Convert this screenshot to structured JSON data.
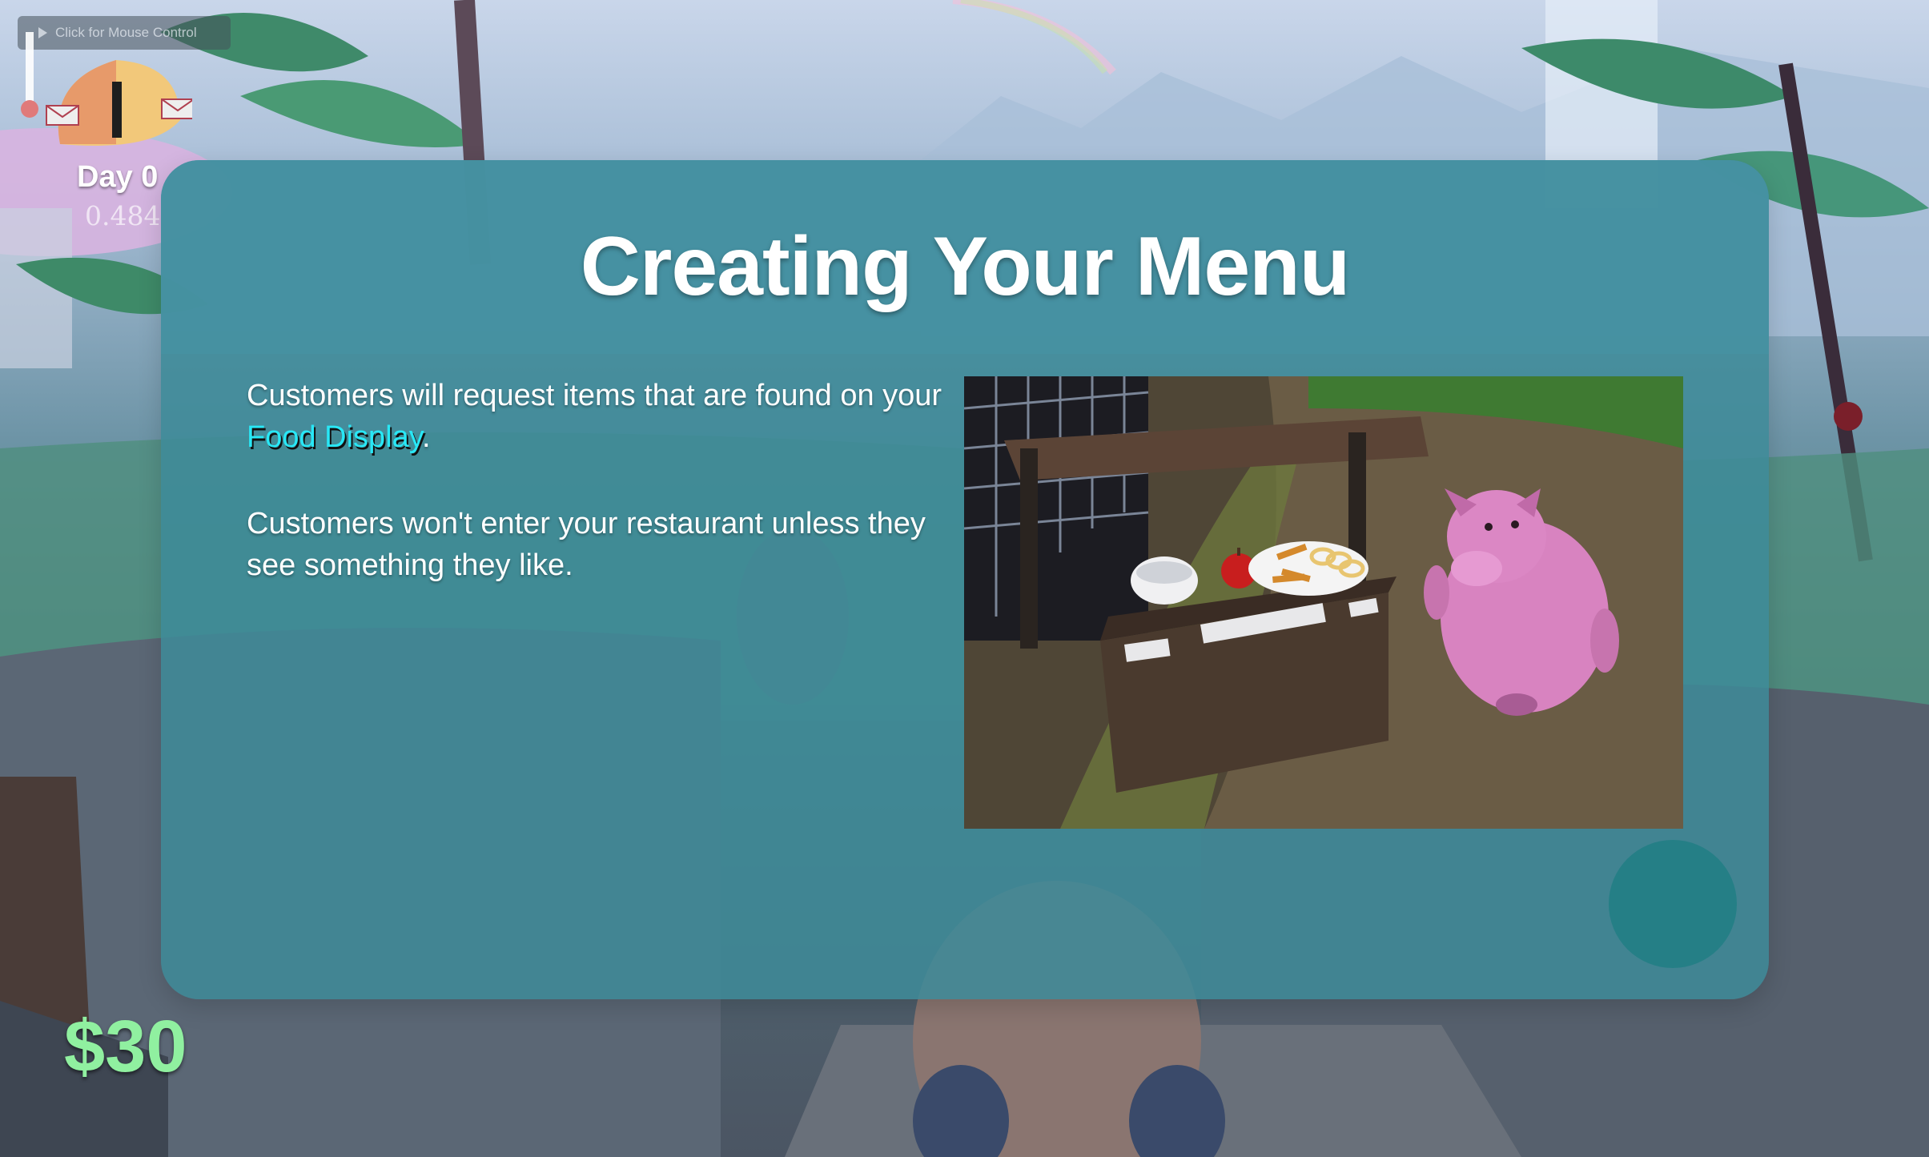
{
  "hud": {
    "mouse_hint": "Click for Mouse Control",
    "day_label": "Day 0",
    "time_value": "0.484",
    "money": "$30"
  },
  "dialog": {
    "title": "Creating Your Menu",
    "paragraph1_text": "Customers will request items that are found on your",
    "paragraph1_highlight": "Food Display",
    "paragraph1_end": ".",
    "paragraph2": "Customers won't enter your restaurant unless they see something they like."
  },
  "colors": {
    "panel": "#3e8a98",
    "highlight": "#28e8f6",
    "money": "#90f0a0",
    "next_button": "#257f86"
  }
}
